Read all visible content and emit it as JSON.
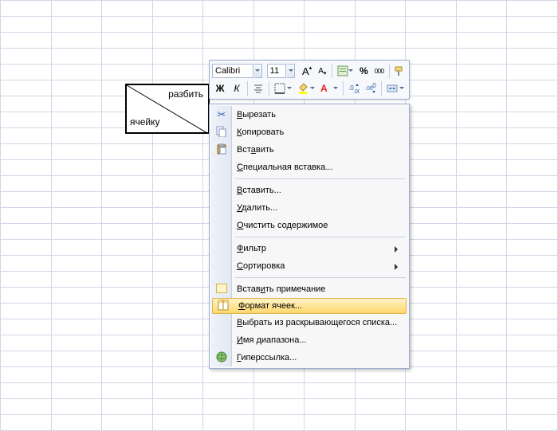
{
  "split_cell": {
    "top_right": "разбить",
    "bottom_left": "ячейку"
  },
  "mini_toolbar": {
    "font_name": "Calibri",
    "font_size": "11",
    "grow_font": "A",
    "shrink_font": "A",
    "bold": "Ж",
    "italic": "К",
    "percent": "%",
    "thousands": "000"
  },
  "menu": {
    "cut": {
      "label": "Вырезать",
      "accel": "В"
    },
    "copy": {
      "label": "Копировать",
      "accel": "К"
    },
    "paste": {
      "label": "Вставить",
      "accel": "а"
    },
    "paste_special": {
      "label": "Специальная вставка...",
      "accel": "С"
    },
    "insert": {
      "label": "Вставить...",
      "accel": "В"
    },
    "delete": {
      "label": "Удалить...",
      "accel": "У"
    },
    "clear": {
      "label": "Очистить содержимое",
      "accel": "О"
    },
    "filter": {
      "label": "Фильтр",
      "accel": "Ф"
    },
    "sort": {
      "label": "Сортировка",
      "accel": "С"
    },
    "comment": {
      "label": "Вставить примечание",
      "accel": "и"
    },
    "format": {
      "label": "Формат ячеек...",
      "accel": "Ф"
    },
    "pick": {
      "label": "Выбрать из раскрывающегося списка...",
      "accel": "В"
    },
    "name": {
      "label": "Имя диапазона...",
      "accel": "И"
    },
    "hyperlink": {
      "label": "Гиперссылка...",
      "accel": "Г"
    }
  }
}
